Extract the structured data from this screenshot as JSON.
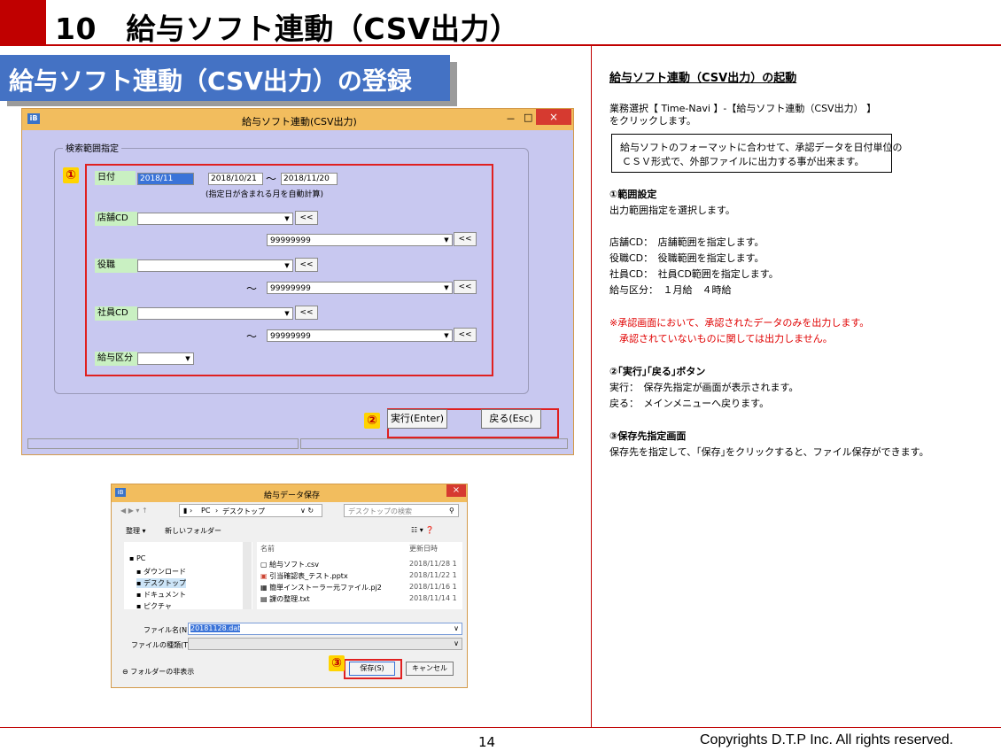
{
  "header": {
    "title": "10　給与ソフト連動（CSV出力）"
  },
  "banner": {
    "text": "給与ソフト連動（CSV出力）の登録"
  },
  "win1": {
    "title": "給与ソフト連動(CSV出力)",
    "minimize": "－",
    "maximize": "□",
    "close": "×",
    "group_label": "検索範囲指定",
    "badge1": "①",
    "badge2": "②",
    "date_label": "日付",
    "date_value": "2018/11",
    "date_from": "2018/10/21",
    "date_tilde": "～",
    "date_to": "2018/11/20",
    "date_note": "(指定日が含まれる月を自動計算)",
    "store_label": "店舗CD",
    "store_to": "99999999",
    "role_label": "役職",
    "role_tilde": "～",
    "role_to": "99999999",
    "emp_label": "社員CD",
    "emp_tilde": "～",
    "emp_to": "99999999",
    "pay_label": "給与区分",
    "copy_btn": "<<",
    "run_btn": "実行(Enter)",
    "back_btn": "戻る(Esc)"
  },
  "win2": {
    "title": "給与データ保存",
    "path_pc": "PC",
    "path_desk": "デスクトップ",
    "search_placeholder": "デスクトップの検索",
    "organize": "整理 ▾",
    "new_folder": "新しいフォルダー",
    "tree": [
      "PC",
      "ダウンロード",
      "デスクトップ",
      "ドキュメント",
      "ピクチャ"
    ],
    "col_name": "名前",
    "col_date": "更新日時",
    "files": [
      {
        "name": "給与ソフト.csv",
        "date": "2018/11/28 1"
      },
      {
        "name": "引当確認表_テスト.pptx",
        "date": "2018/11/22 1"
      },
      {
        "name": "簡単インストーラー元ファイル.pj2",
        "date": "2018/11/16 1"
      },
      {
        "name": "課の整理.txt",
        "date": "2018/11/14 1"
      }
    ],
    "filename_label": "ファイル名(N):",
    "filename_value": "20181128.dat",
    "filetype_label": "ファイルの種類(T):",
    "hide_folders": "フォルダーの非表示",
    "badge3": "③",
    "save_btn": "保存(S)",
    "cancel_btn": "キャンセル"
  },
  "right": {
    "heading": "給与ソフト連動（CSV出力）の起動",
    "intro1": "業務選択【 Time-Navi 】-【給与ソフト連動（CSV出力） 】",
    "intro2": "をクリックします。",
    "note1": "給与ソフトのフォーマットに合わせて、承認データを日付単位の",
    "note2": "ＣＳＶ形式で、外部ファイルに出力する事が出来ます。",
    "s1_title": "①範囲設定",
    "s1_desc": "出力範囲指定を選択します。",
    "s1_l1": "店舗CD：　店舗範囲を指定します。",
    "s1_l2": "役職CD：　役職範囲を指定します。",
    "s1_l3": "社員CD：　社員CD範囲を指定します。",
    "s1_l4": "給与区分：　１月給　４時給",
    "warn1": "※承認画面において、承認されたデータのみを出力します。",
    "warn2": "　承認されていないものに関しては出力しません。",
    "s2_title": "②｢実行｣｢戻る｣ボタン",
    "s2_l1": "実行：　保存先指定が画面が表示されます。",
    "s2_l2": "戻る：　メインメニューへ戻ります。",
    "s3_title": "③保存先指定画面",
    "s3_l1": "保存先を指定して、｢保存｣をクリックすると、ファイル保存ができます。"
  },
  "footer": {
    "page": "14",
    "copyright": "Copyrights  D.T.P Inc. All rights reserved."
  }
}
